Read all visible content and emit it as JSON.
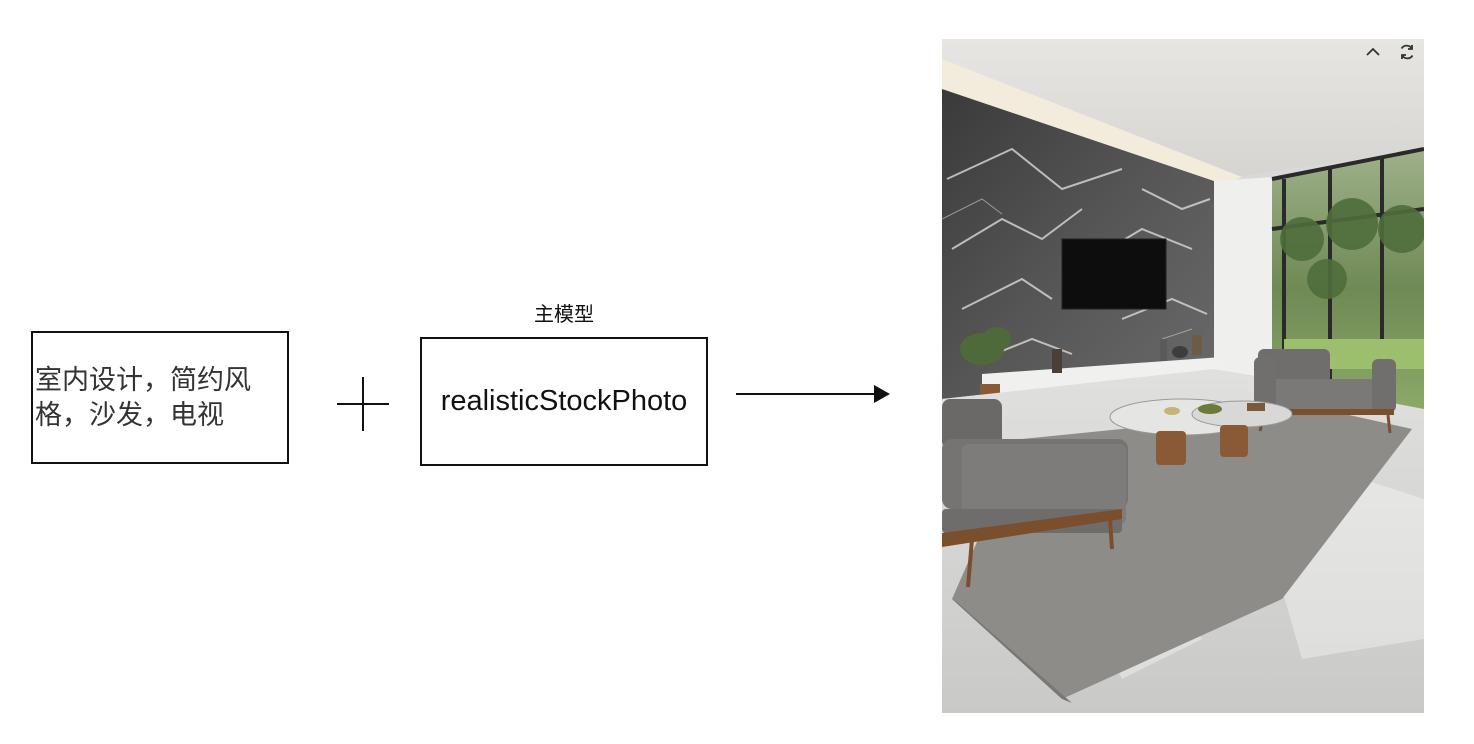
{
  "prompt": {
    "text": "室内设计，简约风格，沙发，电视"
  },
  "operator": {
    "symbol": "plus"
  },
  "model": {
    "caption": "主模型",
    "name": "realisticStockPhoto"
  },
  "result": {
    "image_subject": "generated living room interior with marble TV wall, grey sofas, round coffee tables, rug and floor-to-ceiling windows",
    "controls": {
      "collapse_icon": "chevron-up-icon",
      "refresh_icon": "refresh-icon"
    }
  }
}
